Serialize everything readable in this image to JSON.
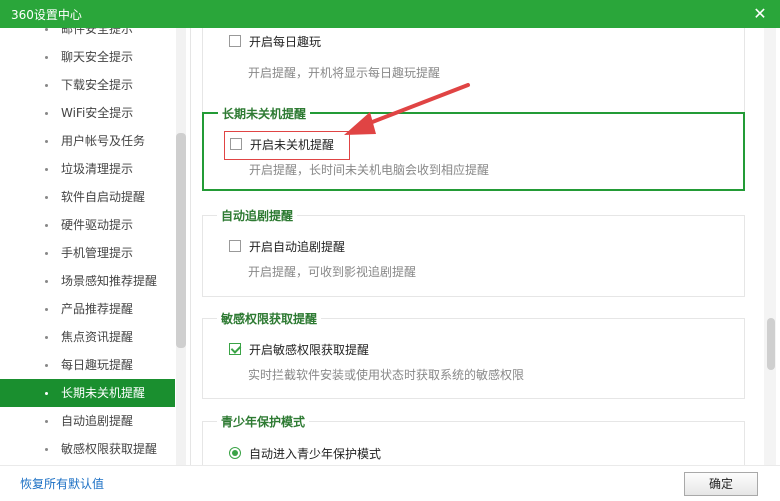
{
  "window": {
    "title": "360设置中心",
    "close_glyph": "✕"
  },
  "sidebar": {
    "items": [
      "邮件安全提示",
      "聊天安全提示",
      "下载安全提示",
      "WiFi安全提示",
      "用户帐号及任务",
      "垃圾清理提示",
      "软件自启动提醒",
      "硬件驱动提示",
      "手机管理提示",
      "场景感知推荐提醒",
      "产品推荐提醒",
      "焦点资讯提醒",
      "每日趣玩提醒",
      "长期未关机提醒",
      "自动追剧提醒",
      "敏感权限获取提醒"
    ],
    "active_index": 13
  },
  "sections": {
    "daily_fun": {
      "option": "开启每日趣玩",
      "desc": "开启提醒，开机将显示每日趣玩提醒",
      "checked": false
    },
    "long_uptime": {
      "title": "长期未关机提醒",
      "option": "开启未关机提醒",
      "desc": "开启提醒，长时间未关机电脑会收到相应提醒",
      "checked": false
    },
    "auto_drama": {
      "title": "自动追剧提醒",
      "option": "开启自动追剧提醒",
      "desc": "开启提醒，可收到影视追剧提醒",
      "checked": false
    },
    "sensitive_perm": {
      "title": "敏感权限获取提醒",
      "option": "开启敏感权限获取提醒",
      "desc": "实时拦截软件安装或使用状态时获取系统的敏感权限",
      "checked": true
    },
    "youth_mode": {
      "title": "青少年保护模式",
      "option": "自动进入青少年保护模式",
      "selected": true
    }
  },
  "footer": {
    "restore_link": "恢复所有默认值",
    "ok_button": "确定"
  },
  "colors": {
    "title_bar": "#2aa63a",
    "active_item": "#1a8f2f",
    "accent": "#239b36",
    "annotation": "#e04444"
  }
}
